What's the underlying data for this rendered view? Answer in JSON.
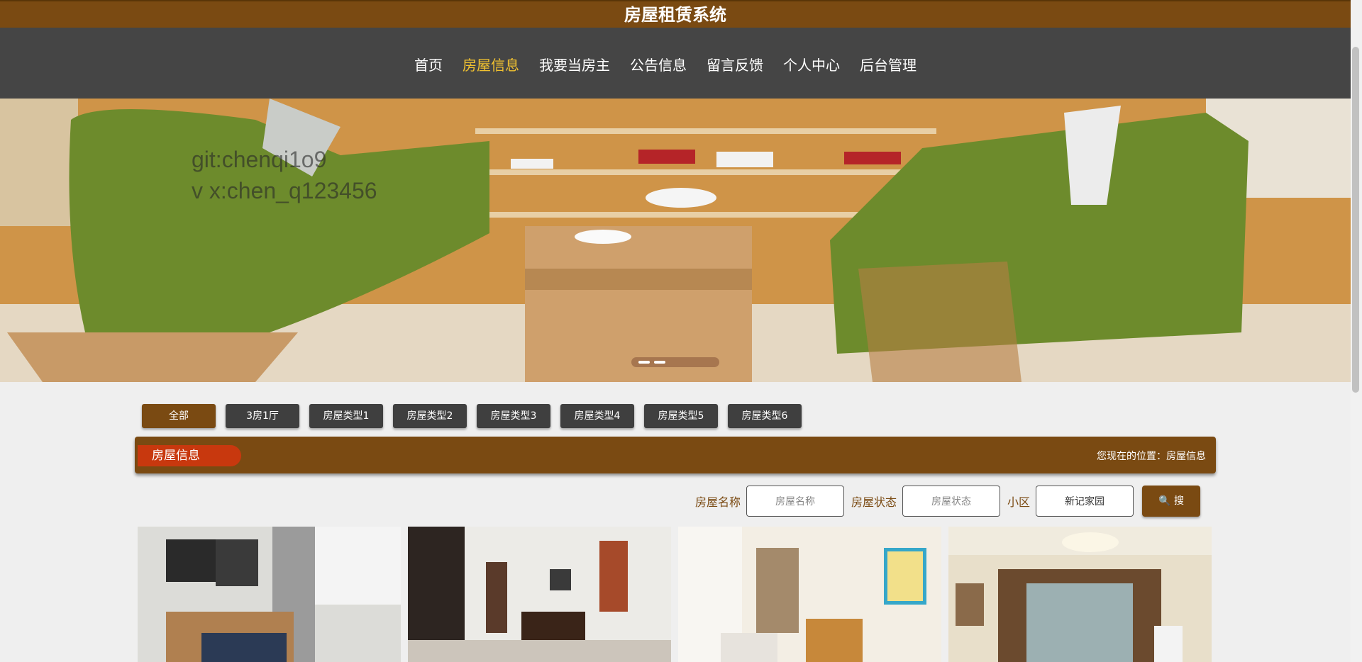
{
  "site_title": "房屋租赁系统",
  "nav": [
    {
      "label": "首页",
      "active": false
    },
    {
      "label": "房屋信息",
      "active": true
    },
    {
      "label": "我要当房主",
      "active": false
    },
    {
      "label": "公告信息",
      "active": false
    },
    {
      "label": "留言反馈",
      "active": false
    },
    {
      "label": "个人中心",
      "active": false
    },
    {
      "label": "后台管理",
      "active": false
    }
  ],
  "banner": {
    "watermark_line1": "git:chenqi1o9",
    "watermark_line2": "v x:chen_q123456"
  },
  "categories": [
    "全部",
    "3房1厅",
    "房屋类型1",
    "房屋类型2",
    "房屋类型3",
    "房屋类型4",
    "房屋类型5",
    "房屋类型6"
  ],
  "section": {
    "title": "房屋信息",
    "breadcrumb": "您现在的位置：房屋信息"
  },
  "search": {
    "name_label": "房屋名称",
    "name_placeholder": "房屋名称",
    "status_label": "房屋状态",
    "status_placeholder": "房屋状态",
    "district_label": "小区",
    "district_value": "新记家园",
    "button_label": "搜"
  },
  "colors": {
    "brand": "#7a4a12",
    "nav_bg": "#454545",
    "active_nav": "#f2c230",
    "section_tag": "#c8380e"
  }
}
